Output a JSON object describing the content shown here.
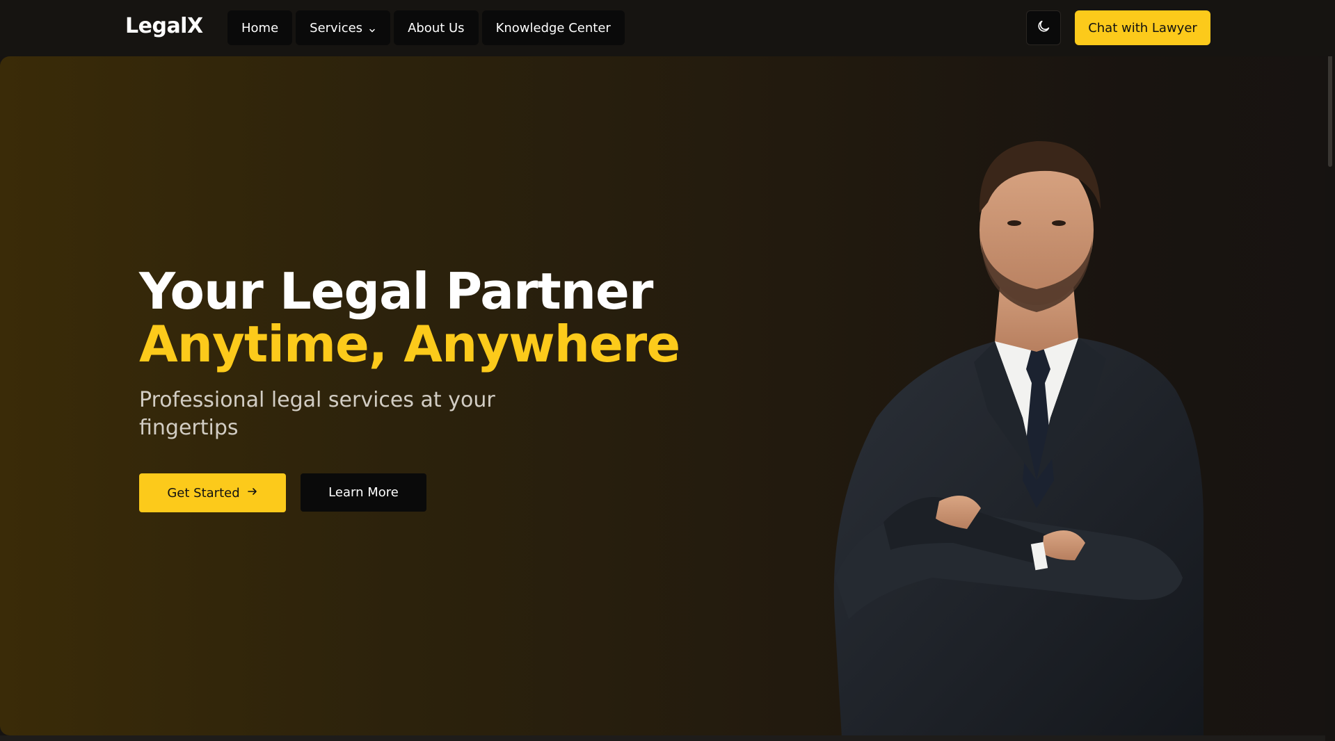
{
  "header": {
    "logo": "LegalX",
    "nav": [
      {
        "label": "Home"
      },
      {
        "label": "Services",
        "has_dropdown": true
      },
      {
        "label": "About Us"
      },
      {
        "label": "Knowledge Center"
      }
    ],
    "theme_toggle_icon": "moon-icon",
    "cta_label": "Chat with Lawyer"
  },
  "hero": {
    "title_line1": "Your Legal Partner",
    "title_line2": "Anytime, Anywhere",
    "subtitle": "Professional legal services at your fingertips",
    "primary_button": "Get Started",
    "primary_button_icon": "arrow-right-icon",
    "secondary_button": "Learn More"
  },
  "colors": {
    "accent": "#fcca1b",
    "background": "#161311",
    "button_dark": "#0a0a0a"
  }
}
